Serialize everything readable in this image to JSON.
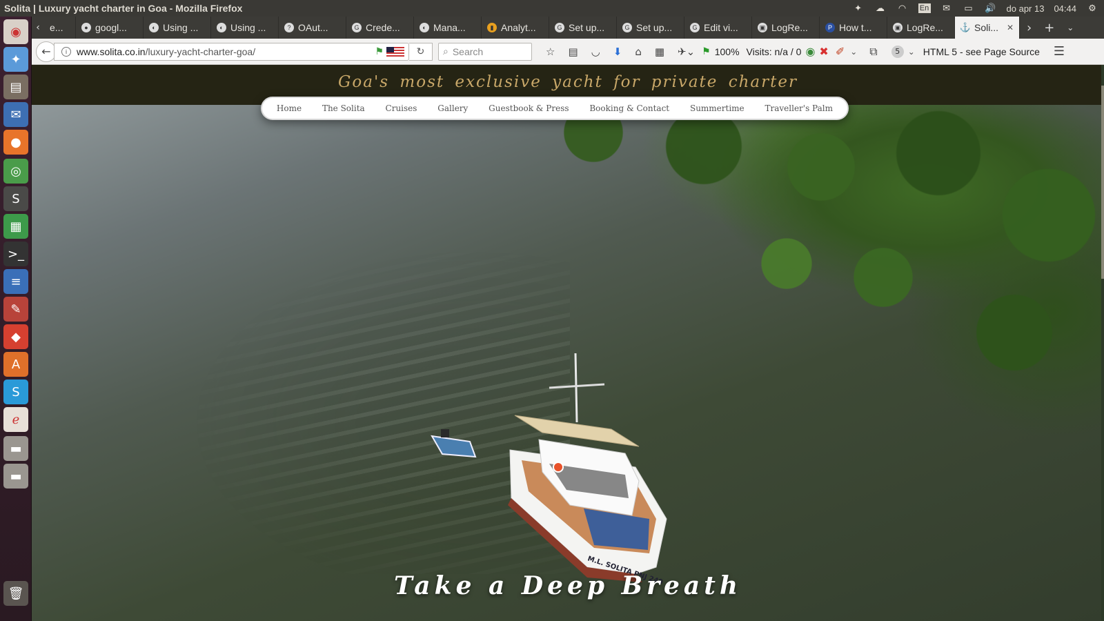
{
  "window": {
    "title": "Solita | Luxury yacht charter in Goa - Mozilla Firefox",
    "tray": {
      "keyboard": "En",
      "date": "do apr 13",
      "time": "04:44"
    }
  },
  "launcher": {
    "icons": [
      "ubuntu-logo-icon",
      "dropbox-icon",
      "file-cabinet-icon",
      "thunderbird-icon",
      "firefox-icon",
      "chrome-icon",
      "sublime-text-icon",
      "spreadsheet-icon",
      "terminal-icon",
      "document-icon",
      "settings-icon",
      "git-icon",
      "software-center-icon",
      "skype-icon",
      "shotwell-icon",
      "drive-icon",
      "drive-icon-2",
      "trash-icon"
    ]
  },
  "tabs": [
    {
      "label": "e...",
      "icon": "generic-icon"
    },
    {
      "label": "googl...",
      "icon": "github-icon"
    },
    {
      "label": "Using ...",
      "icon": "generic-icon"
    },
    {
      "label": "Using ...",
      "icon": "generic-icon"
    },
    {
      "label": "OAut...",
      "icon": "generic-icon"
    },
    {
      "label": "Crede...",
      "icon": "google-icon"
    },
    {
      "label": "Mana...",
      "icon": "generic-icon"
    },
    {
      "label": "Analyt...",
      "icon": "analytics-icon"
    },
    {
      "label": "Set up...",
      "icon": "google-icon"
    },
    {
      "label": "Set up...",
      "icon": "google-icon"
    },
    {
      "label": "Edit vi...",
      "icon": "google-icon"
    },
    {
      "label": "LogRe...",
      "icon": "generic-icon"
    },
    {
      "label": "How t...",
      "icon": "perl-icon"
    },
    {
      "label": "LogRe...",
      "icon": "generic-icon"
    }
  ],
  "active_tab": {
    "label": "Soli...",
    "icon": "anchor-icon"
  },
  "navbar": {
    "url_domain": "www.solita.co.in",
    "url_path": "/luxury-yacht-charter-goa/",
    "search_placeholder": "Search",
    "zoom": "100%",
    "visits": "Visits: n/a / 0",
    "badge_count": "5",
    "html_info": "HTML 5 - see Page Source"
  },
  "site": {
    "tagline": "Goa's most exclusive yacht for private charter",
    "menu": [
      "Home",
      "The Solita",
      "Cruises",
      "Gallery",
      "Guestbook & Press",
      "Booking & Contact",
      "Summertime",
      "Traveller's Palm"
    ],
    "boat_name": "M.L. SOLITA PNJ 249",
    "headline": "Take a Deep Breath"
  },
  "colors": {
    "header_bg": "#252414",
    "tagline": "#c9a869",
    "water": "#4a5545"
  }
}
